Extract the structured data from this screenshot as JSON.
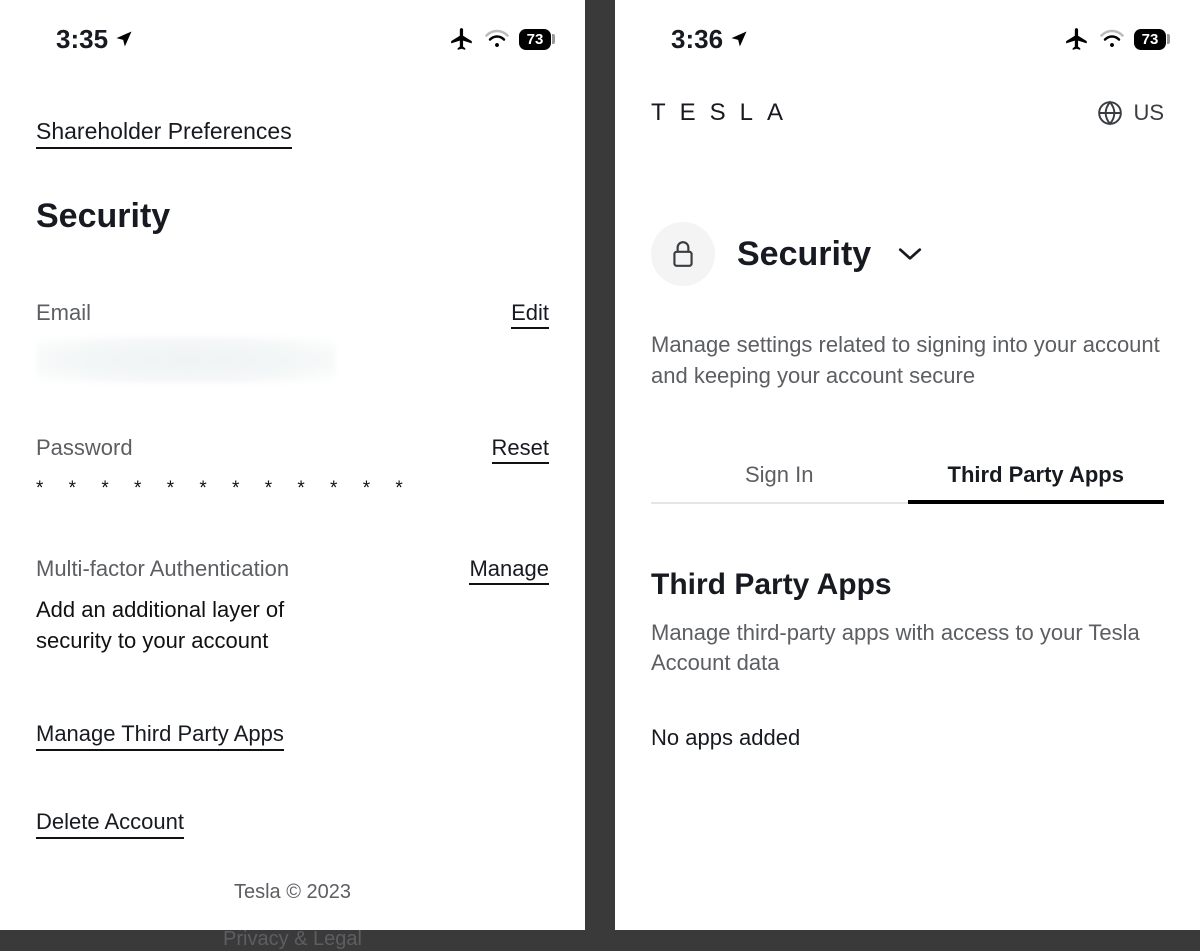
{
  "left": {
    "status": {
      "time": "3:35",
      "battery": "73"
    },
    "shareholder_link": "Shareholder Preferences",
    "section_title": "Security",
    "email": {
      "label": "Email",
      "action": "Edit"
    },
    "password": {
      "label": "Password",
      "action": "Reset",
      "mask": "* * * * * * * * * * * *"
    },
    "mfa": {
      "label": "Multi-factor Authentication",
      "action": "Manage",
      "desc": "Add an additional layer of security to your account"
    },
    "manage_tpa_link": "Manage Third Party Apps",
    "delete_link": "Delete Account",
    "footer1": "Tesla © 2023",
    "footer2": "Privacy & Legal"
  },
  "right": {
    "status": {
      "time": "3:36",
      "battery": "73"
    },
    "brand": "T E S L A",
    "region": "US",
    "security_title": "Security",
    "security_desc": "Manage settings related to signing into your account and keeping your account secure",
    "tabs": {
      "signin": "Sign In",
      "tpa": "Third Party Apps"
    },
    "tpa": {
      "title": "Third Party Apps",
      "desc": "Manage third-party apps with access to your Tesla Account data",
      "empty": "No apps added"
    }
  }
}
